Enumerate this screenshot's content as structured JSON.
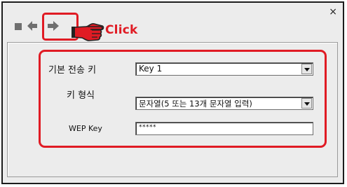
{
  "dialog": {
    "close_glyph": "×"
  },
  "toolbar": {
    "stop_icon": "square-icon",
    "back_icon": "arrow-left-icon",
    "forward_icon": "arrow-right-icon",
    "pointer_icon": "pointing-hand-icon",
    "annotation_label": "Click",
    "highlight_color": "#e01b24"
  },
  "form": {
    "rows": [
      {
        "label": "기본 전송 키",
        "value": "Key 1"
      },
      {
        "label": "키 형식",
        "value": "문자열(5 또는 13개 문자열 입력)"
      },
      {
        "label": "WEP Key",
        "value": "*****"
      }
    ]
  }
}
